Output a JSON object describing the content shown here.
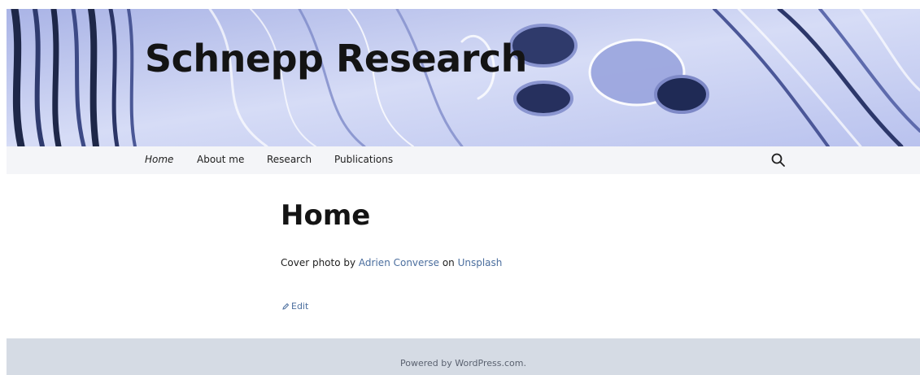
{
  "site": {
    "title": "Schnepp Research"
  },
  "nav": {
    "items": [
      {
        "label": "Home",
        "active": true
      },
      {
        "label": "About me",
        "active": false
      },
      {
        "label": "Research",
        "active": false
      },
      {
        "label": "Publications",
        "active": false
      }
    ],
    "search_icon": "search-icon"
  },
  "page": {
    "title": "Home",
    "caption_prefix": "Cover photo by ",
    "photographer": "Adrien Converse",
    "caption_middle": " on ",
    "source": "Unsplash",
    "edit_label": "Edit",
    "edit_icon": "pencil-icon"
  },
  "footer": {
    "text": "Powered by WordPress.com."
  },
  "colors": {
    "link": "#4b6e9e",
    "nav_bg": "#f4f5f8",
    "footer_bg": "#d5dbe4",
    "banner_base": "#c4cbee",
    "banner_dark": "#1e2748"
  }
}
